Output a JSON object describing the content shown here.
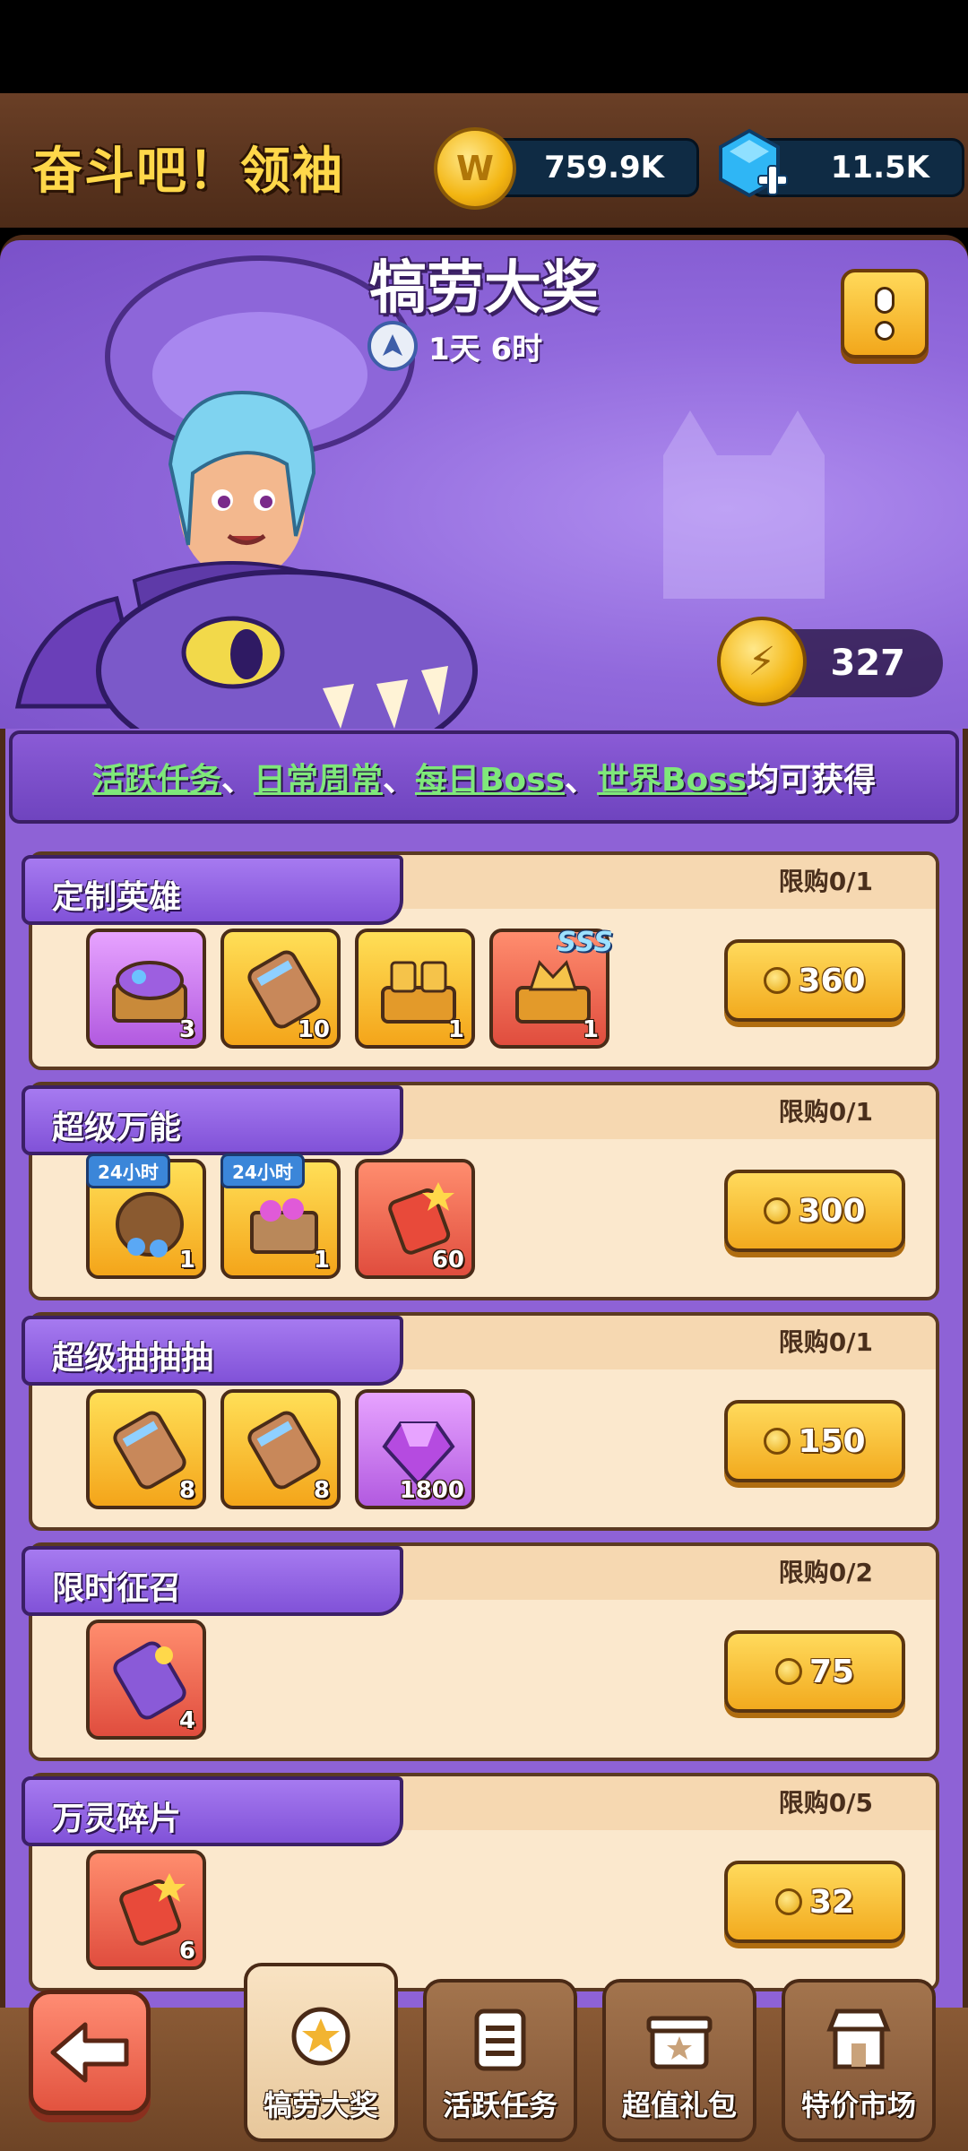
{
  "header": {
    "title": "奋斗吧！领袖",
    "coins": "759.9K",
    "gems": "11.5K"
  },
  "hero": {
    "title": "犒劳大奖",
    "timer": "1天 6时",
    "token_count": "327"
  },
  "notice": {
    "link1": "活跃任务",
    "sep1": "、",
    "link2": "日常周常",
    "sep2": "、",
    "link3": "每日Boss",
    "sep3": "、",
    "link4": "世界Boss",
    "tail": "均可获得"
  },
  "rows": [
    {
      "title": "定制英雄",
      "limit": "限购0/1",
      "price": "360",
      "items": [
        {
          "icon": "chest-icon",
          "qty": "3",
          "bg": "purple"
        },
        {
          "icon": "scroll-icon",
          "qty": "10",
          "bg": "gold"
        },
        {
          "icon": "golden-chest-icon",
          "qty": "1",
          "bg": "gold"
        },
        {
          "icon": "legendary-chest-icon",
          "qty": "1",
          "bg": "red",
          "badge": "SSS"
        }
      ]
    },
    {
      "title": "超级万能",
      "limit": "限购0/1",
      "price": "300",
      "items": [
        {
          "icon": "gem-bag-icon",
          "qty": "1",
          "bg": "gold",
          "tag": "24小时"
        },
        {
          "icon": "gem-crate-icon",
          "qty": "1",
          "bg": "gold",
          "tag": "24小时"
        },
        {
          "icon": "potion-shard-icon",
          "qty": "60",
          "bg": "red"
        }
      ]
    },
    {
      "title": "超级抽抽抽",
      "limit": "限购0/1",
      "price": "150",
      "items": [
        {
          "icon": "scroll-icon",
          "qty": "8",
          "bg": "gold"
        },
        {
          "icon": "scroll-icon",
          "qty": "8",
          "bg": "gold"
        },
        {
          "icon": "purple-gem-icon",
          "qty": "1800",
          "bg": "purple"
        }
      ]
    },
    {
      "title": "限时征召",
      "limit": "限购0/2",
      "price": "75",
      "items": [
        {
          "icon": "purple-scroll-icon",
          "qty": "4",
          "bg": "red"
        }
      ]
    },
    {
      "title": "万灵碎片",
      "limit": "限购0/5",
      "price": "32",
      "items": [
        {
          "icon": "potion-shard-icon",
          "qty": "6",
          "bg": "red"
        }
      ]
    }
  ],
  "nav": {
    "tabs": [
      {
        "label": "犒劳大奖",
        "active": true
      },
      {
        "label": "活跃任务",
        "active": false
      },
      {
        "label": "超值礼包",
        "active": false
      },
      {
        "label": "特价市场",
        "active": false
      }
    ]
  },
  "colors": {
    "brand_purple": "#8e62d6",
    "gold": "#f4a51a",
    "link_green": "#7fe87a",
    "wood_brown": "#6e4426"
  }
}
